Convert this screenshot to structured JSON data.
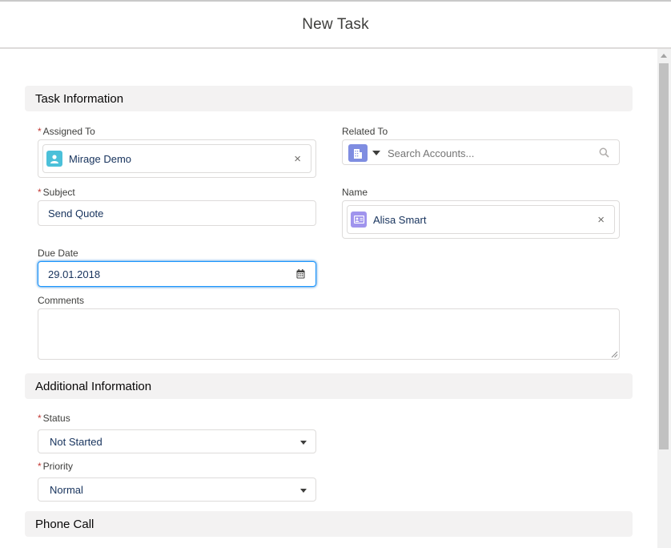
{
  "modal": {
    "title": "New Task"
  },
  "sections": {
    "task_info": "Task Information",
    "additional_info": "Additional Information",
    "phone_call": "Phone Call"
  },
  "fields": {
    "assigned_to": {
      "label": "Assigned To",
      "required_mark": "*",
      "value": "Mirage Demo"
    },
    "related_to": {
      "label": "Related To",
      "placeholder": "Search Accounts..."
    },
    "subject": {
      "label": "Subject",
      "required_mark": "*",
      "value": "Send Quote"
    },
    "name": {
      "label": "Name",
      "value": "Alisa Smart"
    },
    "due_date": {
      "label": "Due Date",
      "value": "29.01.2018"
    },
    "comments": {
      "label": "Comments",
      "value": ""
    },
    "status": {
      "label": "Status",
      "required_mark": "*",
      "value": "Not Started"
    },
    "priority": {
      "label": "Priority",
      "required_mark": "*",
      "value": "Normal"
    }
  },
  "icons": {
    "remove": "×",
    "user_avatar_color": "#4bc0d9",
    "account_icon_color": "#7f8de1",
    "contact_icon_color": "#a094ed"
  },
  "colors": {
    "required": "#c23934",
    "focus_border": "#1b96ff",
    "section_bg": "#f3f2f2"
  }
}
